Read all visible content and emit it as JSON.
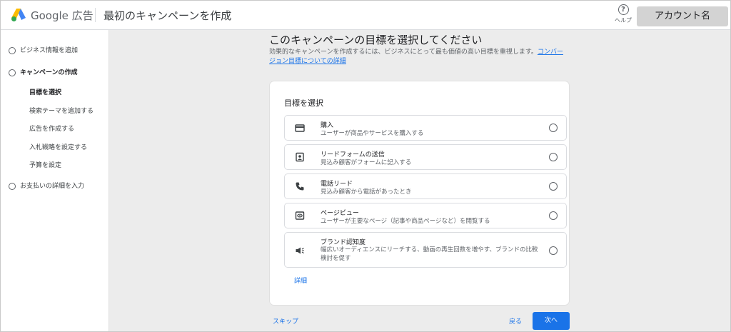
{
  "header": {
    "brand": "Google 広告",
    "title": "最初のキャンペーンを作成",
    "help_label": "ヘルプ",
    "help_symbol": "?",
    "account_label": "アカウント名"
  },
  "sidebar": {
    "steps": [
      {
        "label": "ビジネス情報を追加"
      },
      {
        "label": "キャンペーンの作成"
      },
      {
        "label": "お支払いの詳細を入力"
      }
    ],
    "substeps": [
      {
        "label": "目標を選択"
      },
      {
        "label": "検索テーマを追加する"
      },
      {
        "label": "広告を作成する"
      },
      {
        "label": "入札戦略を設定する"
      },
      {
        "label": "予算を設定"
      }
    ]
  },
  "main": {
    "title": "このキャンペーンの目標を選択してください",
    "description": "効果的なキャンペーンを作成するには、ビジネスにとって最も価値の高い目標を重視します。",
    "description_link": "コンバージョン目標についての詳細",
    "card_title": "目標を選択",
    "options": [
      {
        "title": "購入",
        "desc": "ユーザーが商品やサービスを購入する",
        "icon": "credit-card-icon"
      },
      {
        "title": "リードフォームの送信",
        "desc": "見込み顧客がフォームに記入する",
        "icon": "contact-form-icon"
      },
      {
        "title": "電話リード",
        "desc": "見込み顧客から電話があったとき",
        "icon": "phone-icon"
      },
      {
        "title": "ページビュー",
        "desc": "ユーザーが主要なページ（記事や商品ページなど）を閲覧する",
        "icon": "page-view-icon"
      },
      {
        "title": "ブランド認知度",
        "desc": "幅広いオーディエンスにリーチする、動画の再生回数を増やす、ブランドの比較検討を促す",
        "icon": "megaphone-icon"
      }
    ],
    "details_link": "詳細",
    "skip_label": "スキップ",
    "back_label": "戻る",
    "next_label": "次へ"
  },
  "colors": {
    "accent": "#1a73e8",
    "main_bg": "#ececec",
    "account_button_bg": "#d3d3d3"
  }
}
